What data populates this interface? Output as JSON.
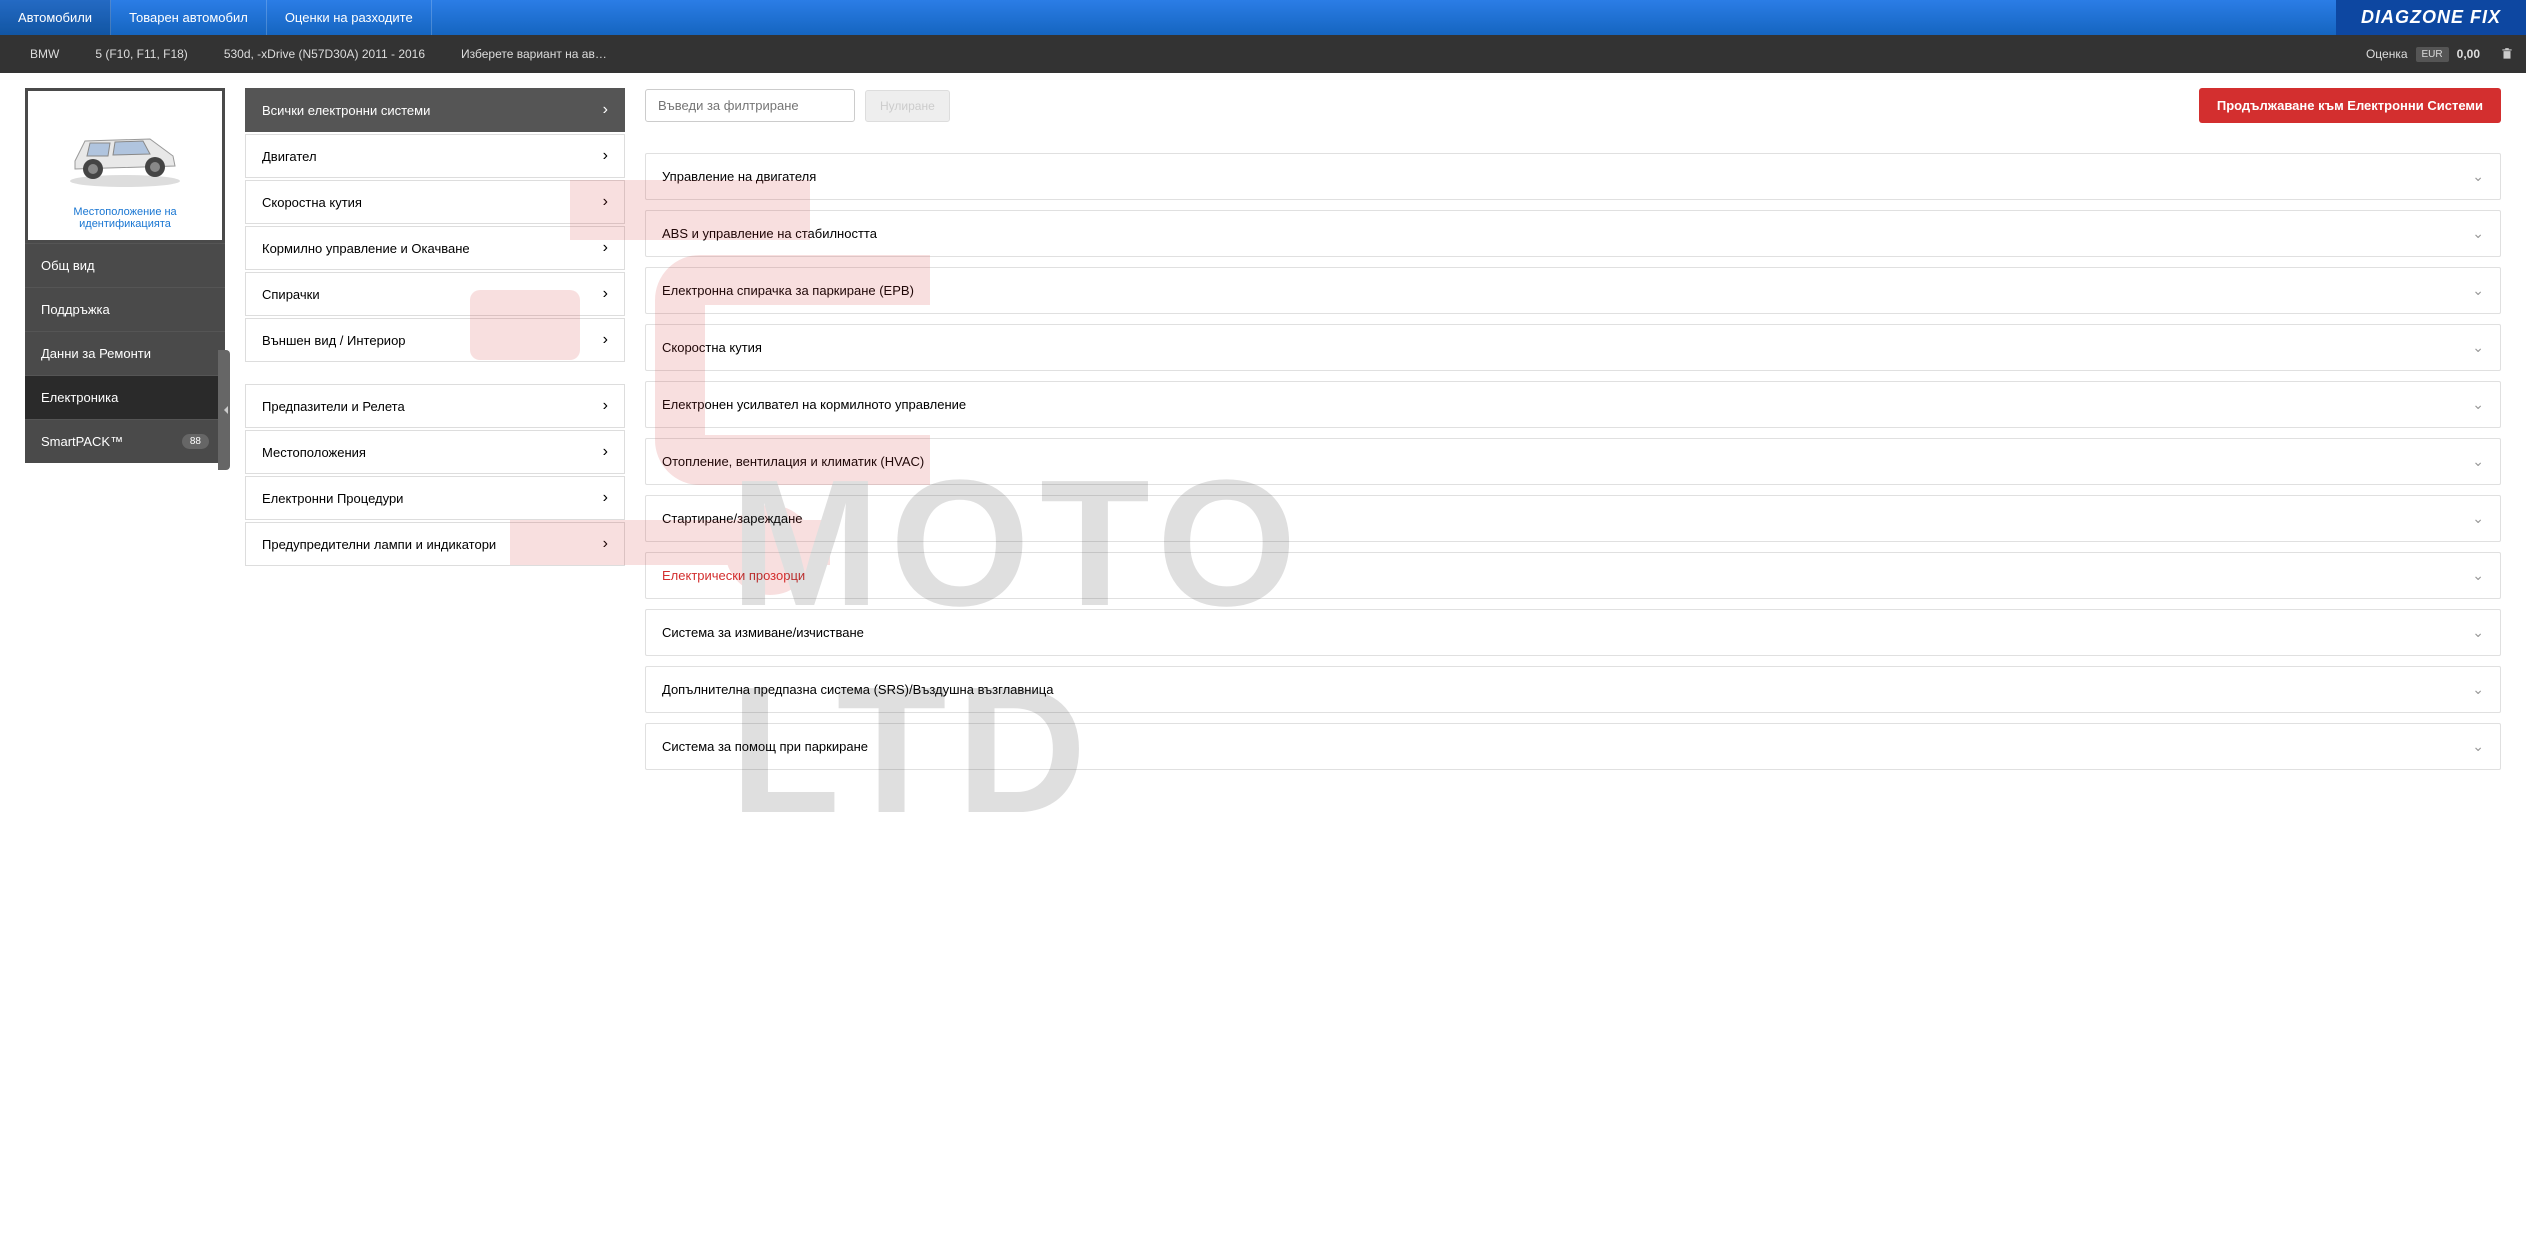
{
  "topnav": {
    "items": [
      "Автомобили",
      "Товарен автомобил",
      "Оценки на разходите"
    ],
    "logo": "DIAGZONE FIX"
  },
  "breadcrumb": {
    "items": [
      "BMW",
      "5 (F10, F11, F18)",
      "530d, -xDrive (N57D30A) 2011 - 2016",
      "Изберете вариант на ав…"
    ],
    "estimate_label": "Оценка",
    "currency": "EUR",
    "value": "0,00"
  },
  "sidebar": {
    "vehicle_link": "Местоположение на идентификацията",
    "items": [
      {
        "label": "Общ вид"
      },
      {
        "label": "Поддръжка"
      },
      {
        "label": "Данни за Ремонти"
      },
      {
        "label": "Електроника",
        "active": true
      },
      {
        "label": "SmartPACK™",
        "badge": "88"
      }
    ]
  },
  "categories": [
    {
      "label": "Всички електронни системи",
      "active": true
    },
    {
      "label": "Двигател"
    },
    {
      "label": "Скоростна кутия"
    },
    {
      "label": "Кормилно управление и Окачване"
    },
    {
      "label": "Спирачки"
    },
    {
      "label": "Външен вид / Интериор"
    },
    {
      "gap": true
    },
    {
      "label": "Предпазители и Релета"
    },
    {
      "label": "Местоположения"
    },
    {
      "label": "Електронни Процедури"
    },
    {
      "label": "Предупредителни лампи и индикатори"
    }
  ],
  "main": {
    "filter_placeholder": "Въведи за филтриране",
    "reset_label": "Нулиране",
    "continue_label": "Продължаване към Електронни Системи",
    "systems": [
      {
        "label": "Управление на двигателя"
      },
      {
        "label": "ABS и управление на стабилността"
      },
      {
        "label": "Електронна спирачка за паркиране (EPB)"
      },
      {
        "label": "Скоростна кутия"
      },
      {
        "label": "Електронен усилвател на кормилното управление"
      },
      {
        "label": "Отопление, вентилация и климатик (HVAC)"
      },
      {
        "label": "Стартиране/зареждане"
      },
      {
        "label": "Електрически прозорци",
        "highlighted": true
      },
      {
        "label": "Система за измиване/изчистване"
      },
      {
        "label": "Допълнителна предпазна система (SRS)/Въздушна възглавница"
      },
      {
        "label": "Система за помощ при паркиране"
      }
    ]
  },
  "watermark": "MOTO LTD"
}
